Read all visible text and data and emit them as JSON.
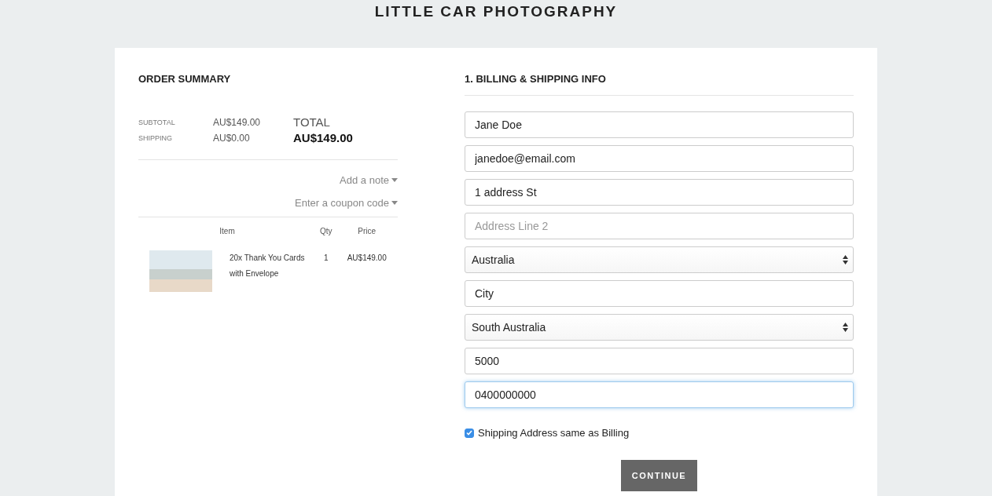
{
  "store": {
    "title": "LITTLE CAR PHOTOGRAPHY"
  },
  "order_summary": {
    "heading": "ORDER SUMMARY",
    "lines": [
      {
        "label": "SUBTOTAL",
        "amount": "AU$149.00"
      },
      {
        "label": "SHIPPING",
        "amount": "AU$0.00"
      }
    ],
    "total": {
      "label": "TOTAL",
      "amount": "AU$149.00"
    },
    "toggles": [
      "Add a note",
      "Enter a coupon code"
    ],
    "table": {
      "columns": [
        "Item",
        "Qty",
        "Price"
      ],
      "rows": [
        {
          "name": "20x Thank You Cards with Envelope",
          "qty": "1",
          "price": "AU$149.00"
        }
      ]
    }
  },
  "billing": {
    "heading": "1. BILLING & SHIPPING INFO",
    "fields": [
      {
        "kind": "text",
        "value": "Jane Doe",
        "focused": false
      },
      {
        "kind": "text",
        "value": "janedoe@email.com",
        "focused": false
      },
      {
        "kind": "text",
        "value": "1 address St",
        "focused": false
      },
      {
        "kind": "text",
        "placeholder": "Address Line 2",
        "focused": false
      },
      {
        "kind": "select",
        "value": "Australia",
        "focused": false
      },
      {
        "kind": "text",
        "value": "City",
        "focused": false
      },
      {
        "kind": "select",
        "value": "South Australia",
        "focused": false
      },
      {
        "kind": "text",
        "value": "5000",
        "focused": false
      },
      {
        "kind": "text",
        "value": "0400000000",
        "focused": true
      }
    ],
    "same_address": {
      "label": "Shipping Address same as Billing",
      "checked": true
    },
    "button": "CONTINUE"
  }
}
